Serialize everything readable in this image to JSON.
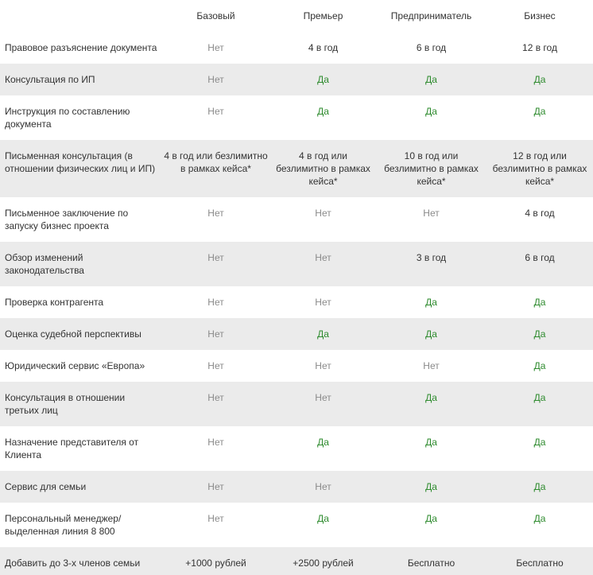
{
  "plans": [
    "Базовый",
    "Премьер",
    "Предприниматель",
    "Бизнес"
  ],
  "rows": [
    {
      "feature": "Правовое разъяснение документа",
      "values": [
        "Нет",
        "4 в год",
        "6 в год",
        "12 в год"
      ]
    },
    {
      "feature": "Консультация по ИП",
      "values": [
        "Нет",
        "Да",
        "Да",
        "Да"
      ]
    },
    {
      "feature": "Инструкция по составлению документа",
      "values": [
        "Нет",
        "Да",
        "Да",
        "Да"
      ]
    },
    {
      "feature": "Письменная консультация (в отношении физических лиц и ИП)",
      "values": [
        "4 в год или безлимитно в рамках кейса*",
        "4 в год или безлимитно в рамках кейса*",
        "10 в год или безлимитно в рамках кейса*",
        "12 в год или безлимитно в рамках кейса*"
      ]
    },
    {
      "feature": "Письменное заключение по запуску бизнес проекта",
      "values": [
        "Нет",
        "Нет",
        "Нет",
        "4 в год"
      ]
    },
    {
      "feature": "Обзор изменений законодательства",
      "values": [
        "Нет",
        "Нет",
        "3 в год",
        "6 в год"
      ]
    },
    {
      "feature": "Проверка контрагента",
      "values": [
        "Нет",
        "Нет",
        "Да",
        "Да"
      ]
    },
    {
      "feature": "Оценка судебной перспективы",
      "values": [
        "Нет",
        "Да",
        "Да",
        "Да"
      ]
    },
    {
      "feature": "Юридический сервис «Европа»",
      "values": [
        "Нет",
        "Нет",
        "Нет",
        "Да"
      ]
    },
    {
      "feature": "Консультация в отношении третьих лиц",
      "values": [
        "Нет",
        "Нет",
        "Да",
        "Да"
      ]
    },
    {
      "feature": "Назначение представителя от Клиента",
      "values": [
        "Нет",
        "Да",
        "Да",
        "Да"
      ]
    },
    {
      "feature": "Сервис для семьи",
      "values": [
        "Нет",
        "Нет",
        "Да",
        "Да"
      ]
    },
    {
      "feature": "Персональный менеджер/ выделенная линия 8 800",
      "values": [
        "Нет",
        "Да",
        "Да",
        "Да"
      ]
    },
    {
      "feature": "Добавить до 3-х членов семьи",
      "values": [
        "+1000 рублей",
        "+2500 рублей",
        "Бесплатно",
        "Бесплатно"
      ]
    }
  ],
  "colors": {
    "yes": "#2e8b2e",
    "no": "#8a8a8a",
    "text": "#333333",
    "stripe": "#ebebeb"
  }
}
